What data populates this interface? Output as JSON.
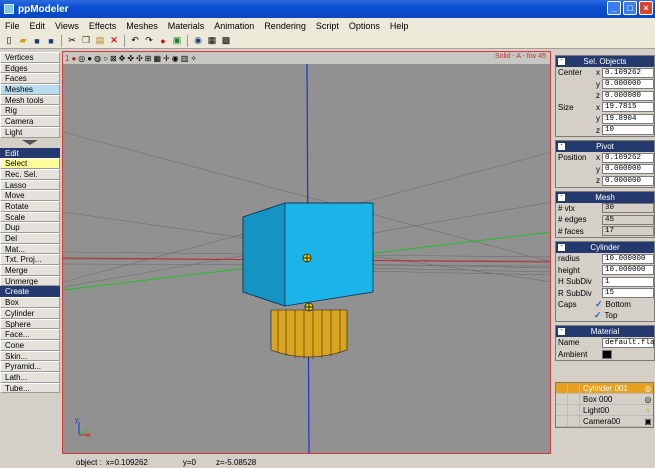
{
  "window": {
    "title": "ppModeler"
  },
  "menu": [
    "File",
    "Edit",
    "Views",
    "Effects",
    "Meshes",
    "Materials",
    "Animation",
    "Rendering",
    "Script",
    "Options",
    "Help"
  ],
  "left_tools": {
    "group1": [
      "Vertices",
      "Edges",
      "Faces",
      "Meshes",
      "Mesh tools",
      "Rig",
      "Camera",
      "Light"
    ],
    "edit_header": "Edit",
    "group2": [
      "Select",
      "Rec. Sel.",
      "Lasso",
      "Move",
      "Rotate",
      "Scale",
      "Dup",
      "Del",
      "Mat...",
      "Txt. Proj...",
      "Merge",
      "Unmerge"
    ],
    "create_header": "Create",
    "group3": [
      "Box",
      "Cylinder",
      "Sphere",
      "Face...",
      "Cone",
      "Skin...",
      "Pyramid...",
      "Lath...",
      "Tube..."
    ]
  },
  "viewport": {
    "label": "Solid - A - fov 45",
    "index": "1"
  },
  "sel_objects": {
    "title": "Sel. Objects",
    "center_label": "Center",
    "center": [
      "0.109262",
      "0.000000",
      "0.000000"
    ],
    "size_label": "Size",
    "size": [
      "19.7815",
      "19.8904",
      "10"
    ]
  },
  "pivot": {
    "title": "Pivot",
    "position_label": "Position",
    "position": [
      "0.109262",
      "0.000000",
      "0.000000"
    ]
  },
  "mesh": {
    "title": "Mesh",
    "vtx_label": "# vtx",
    "vtx": "30",
    "edges_label": "# edges",
    "edges": "45",
    "faces_label": "# faces",
    "faces": "17"
  },
  "cylinder": {
    "title": "Cylinder",
    "radius_label": "radius",
    "radius": "10.000000",
    "height_label": "height",
    "height": "10.000000",
    "hsub_label": "H SubDiv",
    "hsub": "1",
    "rsub_label": "R SubDiv",
    "rsub": "15",
    "caps_label": "Caps",
    "bottom": "Bottom",
    "top": "Top"
  },
  "material": {
    "title": "Material",
    "name_label": "Name",
    "name": "default.fla",
    "ambient_label": "Ambient"
  },
  "objects": [
    "Cylinder 001",
    "Box 000",
    "Light00",
    "Camera00"
  ],
  "status": {
    "object": "object :",
    "x": "x=0.109262",
    "y": "y=0",
    "z": "z=-5.08528"
  },
  "axis_labels": {
    "y": "y",
    "x": "x"
  },
  "colors": {
    "accent": "#243a6e",
    "box": "#1ab4e8",
    "cylinder": "#d9a520",
    "viewport_bg": "#919191"
  }
}
